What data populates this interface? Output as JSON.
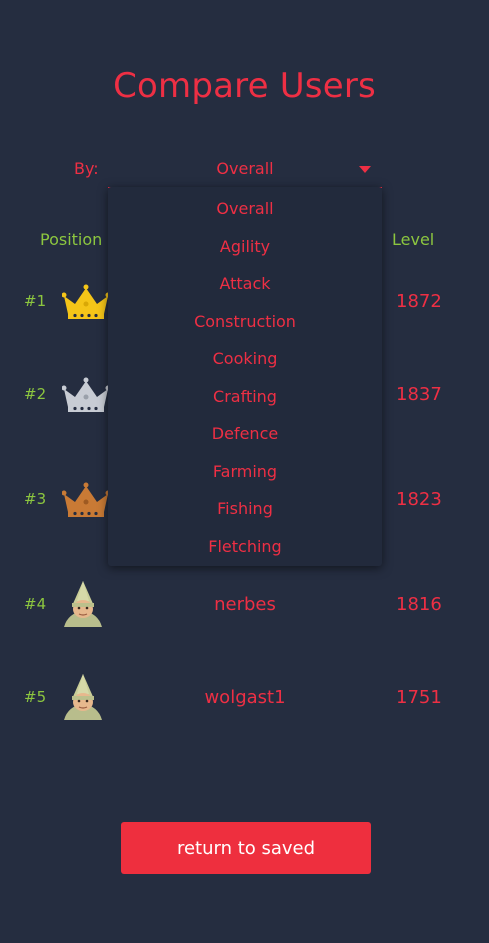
{
  "title": "Compare Users",
  "filter": {
    "label": "By:",
    "selected": "Overall",
    "options": [
      "Overall",
      "Agility",
      "Attack",
      "Construction",
      "Cooking",
      "Crafting",
      "Defence",
      "Farming",
      "Fishing",
      "Fletching"
    ]
  },
  "table": {
    "headers": {
      "position": "Position",
      "level": "Level"
    },
    "rows": [
      {
        "rank": "#1",
        "icon": "gold-crown-icon",
        "name": "",
        "level": "1872"
      },
      {
        "rank": "#2",
        "icon": "silver-crown-icon",
        "name": "",
        "level": "1837"
      },
      {
        "rank": "#3",
        "icon": "bronze-crown-icon",
        "name": "",
        "level": "1823"
      },
      {
        "rank": "#4",
        "icon": "gnome-avatar-icon",
        "name": "nerbes",
        "level": "1816"
      },
      {
        "rank": "#5",
        "icon": "gnome-avatar-icon",
        "name": "wolgast1",
        "level": "1751"
      }
    ]
  },
  "return_button": "return to saved",
  "colors": {
    "background": "#252d40",
    "accent": "#ee2f44",
    "rank_green": "#8cc63f",
    "gold": "#f5c518",
    "silver": "#c8ccd4",
    "bronze": "#c97a35"
  }
}
